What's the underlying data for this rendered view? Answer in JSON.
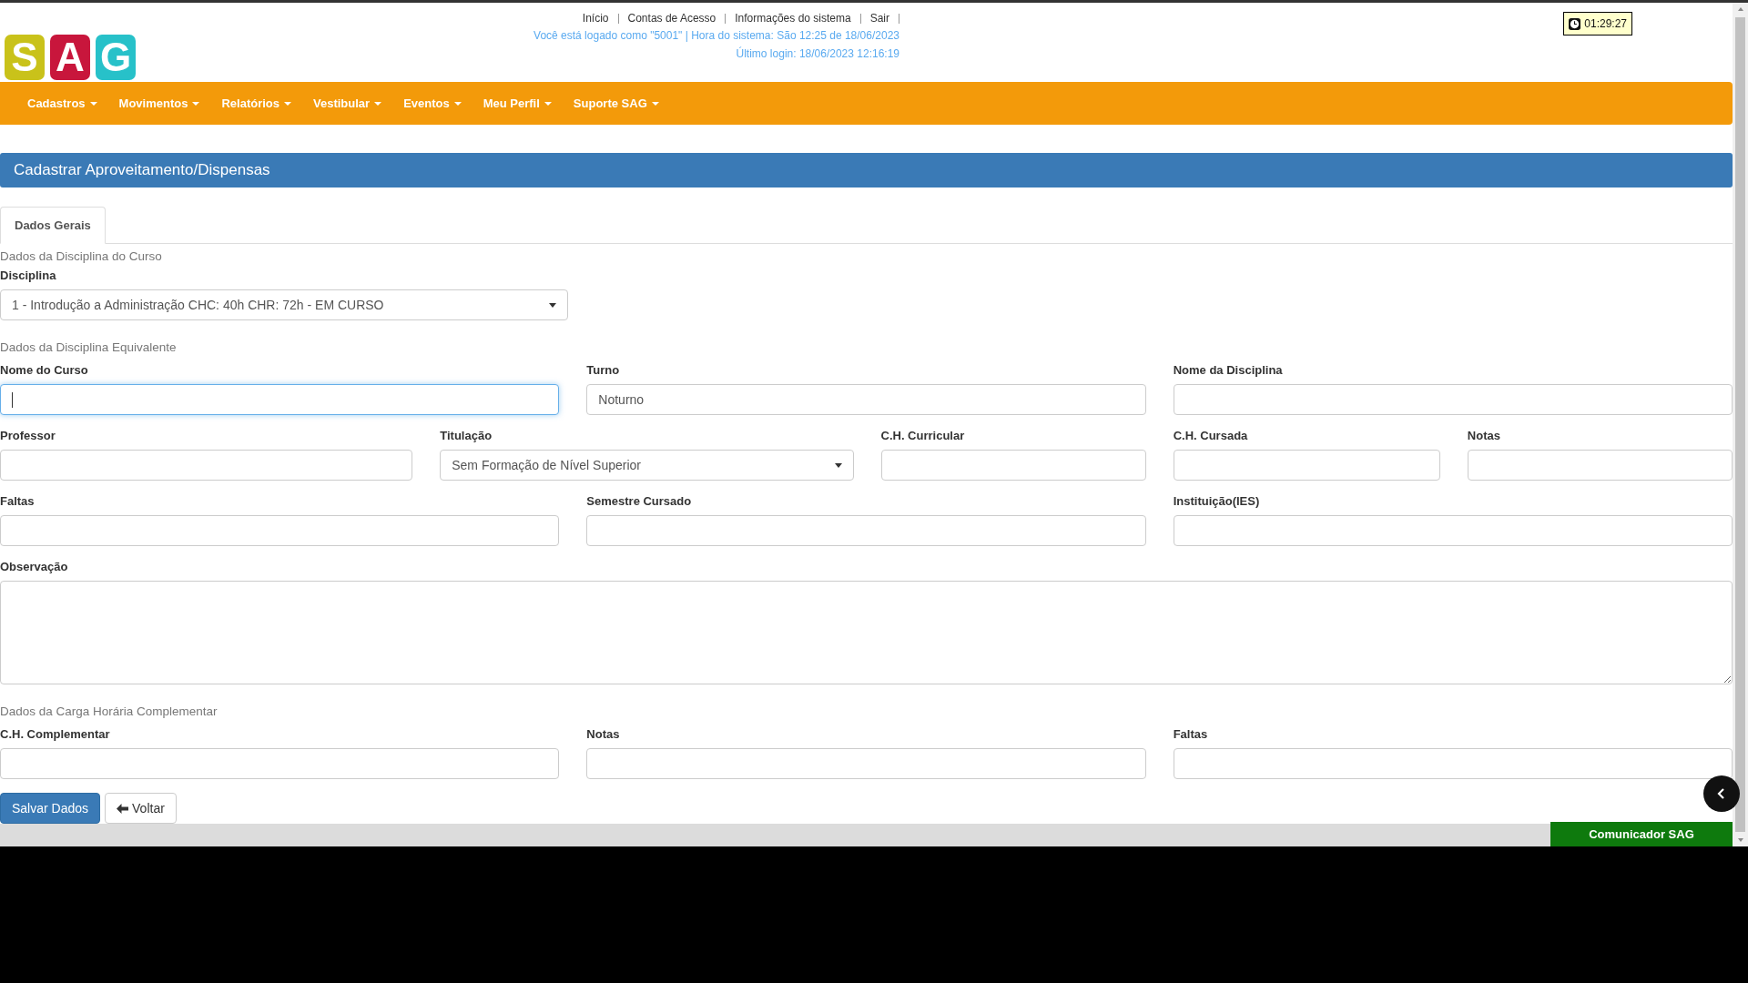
{
  "logo": {
    "letters": [
      {
        "char": "S",
        "color": "#c9c21a"
      },
      {
        "char": "A",
        "color": "#c8163c"
      },
      {
        "char": "G",
        "color": "#27c1c9"
      }
    ]
  },
  "top_links": [
    "Início",
    "Contas de Acesso",
    "Informações do sistema",
    "Sair"
  ],
  "session_info": "Você está logado como \"5001\" | Hora do sistema: São 12:25 de 18/06/2023",
  "last_login": "Último login: 18/06/2023 12:16:19",
  "timer": "01:29:27",
  "nav": [
    "Cadastros",
    "Movimentos",
    "Relatórios",
    "Vestibular",
    "Eventos",
    "Meu Perfil",
    "Suporte SAG"
  ],
  "panel_title": "Cadastrar Aproveitamento/Dispensas",
  "tabs": [
    {
      "label": "Dados Gerais",
      "selected": true
    }
  ],
  "sections": [
    {
      "title": "Dados da Disciplina do Curso",
      "rows": [
        [
          {
            "label": "Disciplina",
            "kind": "select",
            "value": "1 - Introdução a Administração CHC: 40h CHR: 72h - EM CURSO",
            "focused": false
          }
        ]
      ]
    },
    {
      "title": "Dados da Disciplina Equivalente",
      "rows": [
        [
          {
            "label": "Nome do Curso",
            "kind": "text",
            "focused": true
          },
          {
            "label": "Turno",
            "kind": "text",
            "value": "Noturno",
            "focused": false
          },
          {
            "label": "Nome da Disciplina",
            "kind": "text",
            "focused": false
          }
        ],
        [
          {
            "label": "Professor",
            "kind": "text",
            "focused": false
          },
          {
            "label": "Titulação",
            "kind": "select",
            "value": "Sem Formação de Nível Superior",
            "focused": false
          },
          {
            "label": "C.H. Curricular",
            "kind": "text",
            "focused": false
          },
          {
            "label": "C.H. Cursada",
            "kind": "text",
            "focused": false
          },
          {
            "label": "Notas",
            "kind": "text",
            "focused": false
          }
        ],
        [
          {
            "label": "Faltas",
            "kind": "text",
            "focused": false
          },
          {
            "label": "Semestre Cursado",
            "kind": "text",
            "focused": false
          },
          {
            "label": "Instituição(IES)",
            "kind": "text",
            "focused": false
          }
        ],
        [
          {
            "label": "Observação",
            "kind": "textarea",
            "focused": false
          }
        ]
      ]
    },
    {
      "title": "Dados da Carga Horária Complementar",
      "rows": [
        [
          {
            "label": "C.H. Complementar",
            "kind": "text",
            "focused": false
          },
          {
            "label": "Notas",
            "kind": "text",
            "focused": false
          },
          {
            "label": "Faltas",
            "kind": "text",
            "focused": false
          }
        ]
      ]
    }
  ],
  "buttons": [
    {
      "label": "Salvar Dados",
      "kind": "primary"
    },
    {
      "label": "Voltar",
      "kind": "back"
    }
  ],
  "chat_button": "Comunicador SAG"
}
